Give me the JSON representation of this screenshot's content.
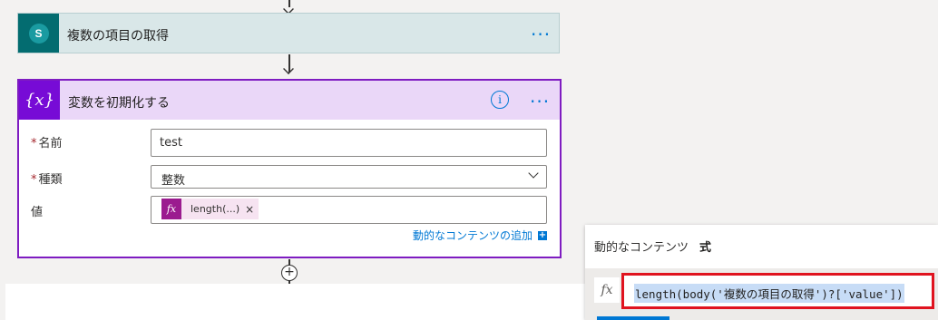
{
  "get_items_card": {
    "title": "複数の項目の取得",
    "icon": "sharepoint-icon",
    "icon_letter": "S",
    "accent": "#036c70",
    "more_label": "···"
  },
  "init_var_card": {
    "title": "変数を初期化する",
    "icon": "variable-icon",
    "icon_glyph": "{x}",
    "accent": "#770bd6",
    "info_glyph": "i",
    "more_label": "···",
    "fields": {
      "name": {
        "label": "名前",
        "required_mark": "*",
        "value": "test"
      },
      "type": {
        "label": "種類",
        "required_mark": "*",
        "value": "整数"
      },
      "value": {
        "label": "値",
        "token_icon": "fx",
        "token_text": "length(...)",
        "token_remove": "×"
      }
    },
    "add_dynamic_label": "動的なコンテンツの追加"
  },
  "add_step_glyph": "+",
  "expression_panel": {
    "tabs": [
      "動的なコンテンツ",
      "式"
    ],
    "active_tab": "式",
    "fx_label": "fx",
    "expression": "length(body('複数の項目の取得')?['value'])",
    "highlight_color": "#e0131f"
  }
}
